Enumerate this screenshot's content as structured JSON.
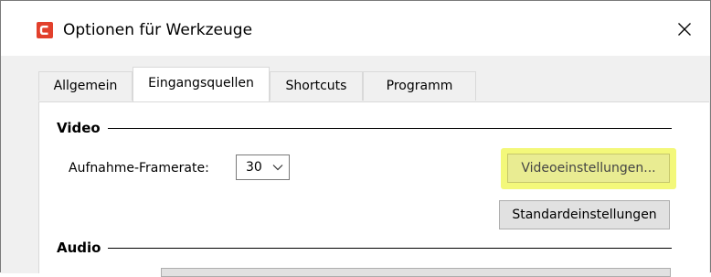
{
  "window": {
    "title": "Optionen für Werkzeuge",
    "close_symbol": "✕",
    "app_icon": "app-logo-icon",
    "brand_color": "#e2402c"
  },
  "tabs": [
    {
      "label": "Allgemein",
      "active": false
    },
    {
      "label": "Eingangsquellen",
      "active": true
    },
    {
      "label": "Shortcuts",
      "active": false
    },
    {
      "label": "Programm",
      "active": false
    }
  ],
  "video": {
    "group_label": "Video",
    "framerate_label": "Aufnahme-Framerate:",
    "framerate_value": "30",
    "video_settings_button": "Videoeinstellungen...",
    "default_settings_button": "Standardeinstellungen",
    "highlight_color": "#f3f87a"
  },
  "audio": {
    "group_label": "Audio"
  }
}
